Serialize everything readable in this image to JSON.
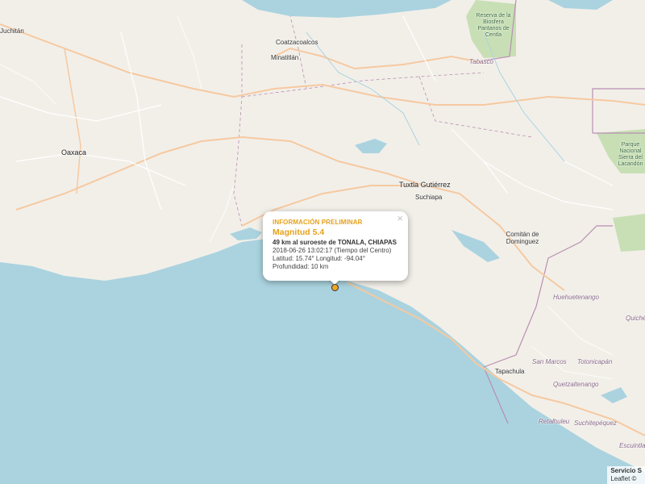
{
  "map": {
    "colors": {
      "land": "#f2efe9",
      "water": "#aad3df",
      "road_major": "#f6c9a0",
      "road_minor": "#ffffff",
      "border": "#b98fb3",
      "park": "#c8dfb5"
    },
    "labels": {
      "juchitan": "Juchitán",
      "oaxaca": "Oaxaca",
      "coatzacoalcos": "Coatzacoalcos",
      "minatitlan": "Minatitlán",
      "tabasco": "Tabasco",
      "reserva": "Reserva de la Biosfera Pantanos de Centla",
      "tuxtla": "Tuxtla Gutiérrez",
      "suchiapa": "Suchiapa",
      "comitan": "Comitán de Dominguez",
      "parque": "Parque Nacional Sierra del Lacandón",
      "huehuetenango": "Huehuetenango",
      "quiche": "Quiché",
      "tapachula": "Tapachula",
      "san_marcos": "San Marcos",
      "totonicapan": "Totonicapán",
      "quetzaltenango": "Quetzaltenango",
      "retalhuleu": "Retalhuleu",
      "suchitepequez": "Suchitepéquez",
      "escuintla": "Escuintla"
    }
  },
  "popup": {
    "header": "INFORMACIÓN PRELIMINAR",
    "magnitude": "Magnitud 5.4",
    "location": "49 km al suroeste de TONALA, CHIAPAS",
    "datetime": "2018-06-26  13:02:17 (Tiempo del Centro)",
    "coords": "Latitud: 15.74°  Longitud: -94.04°",
    "depth": "Profundidad: 10 km",
    "close": "×"
  },
  "attribution": {
    "line1": "Servicio S",
    "line2": "Leaflet © "
  }
}
